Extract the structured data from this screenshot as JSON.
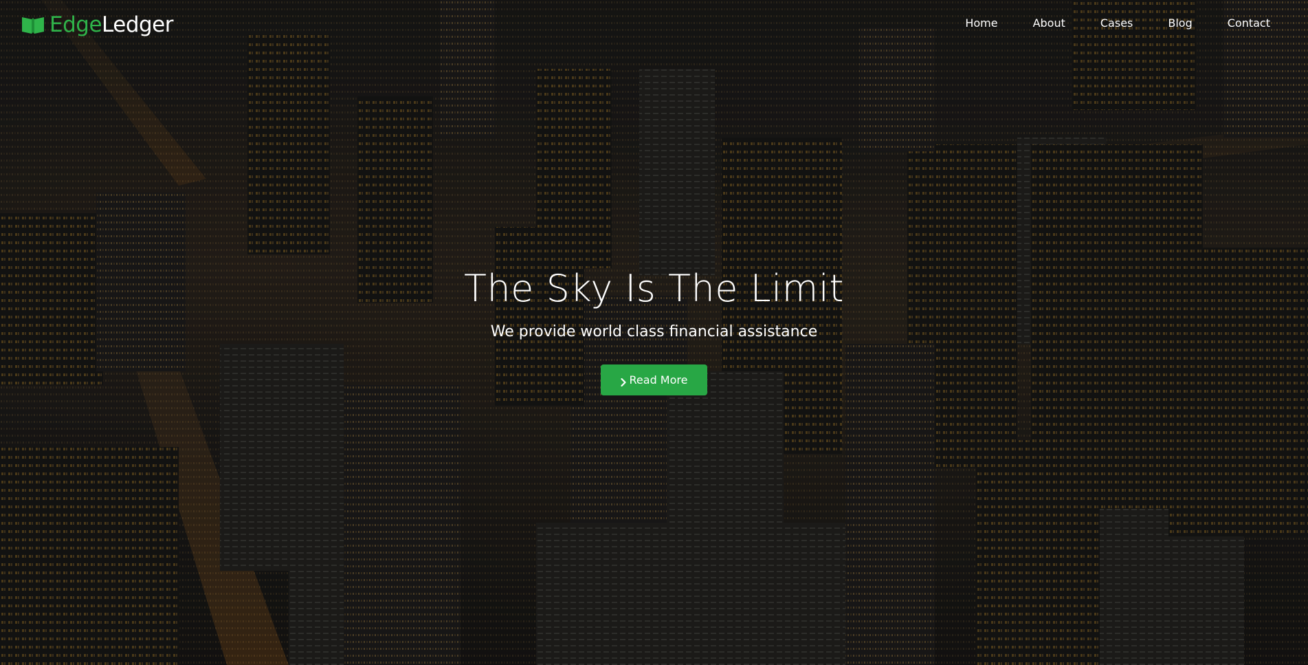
{
  "brand": {
    "name_part1": "Edge",
    "name_part2": "Ledger",
    "icon": "book-icon",
    "accent_color": "#2fb44a"
  },
  "nav": {
    "items": [
      {
        "label": "Home"
      },
      {
        "label": "About"
      },
      {
        "label": "Cases"
      },
      {
        "label": "Blog"
      },
      {
        "label": "Contact"
      }
    ]
  },
  "hero": {
    "title": "The Sky Is The Limit",
    "subtitle": "We provide world class financial assistance",
    "cta_label": "Read More",
    "cta_icon": "chevron-right-icon",
    "cta_color": "#28a745",
    "background": "night aerial city skyline"
  }
}
